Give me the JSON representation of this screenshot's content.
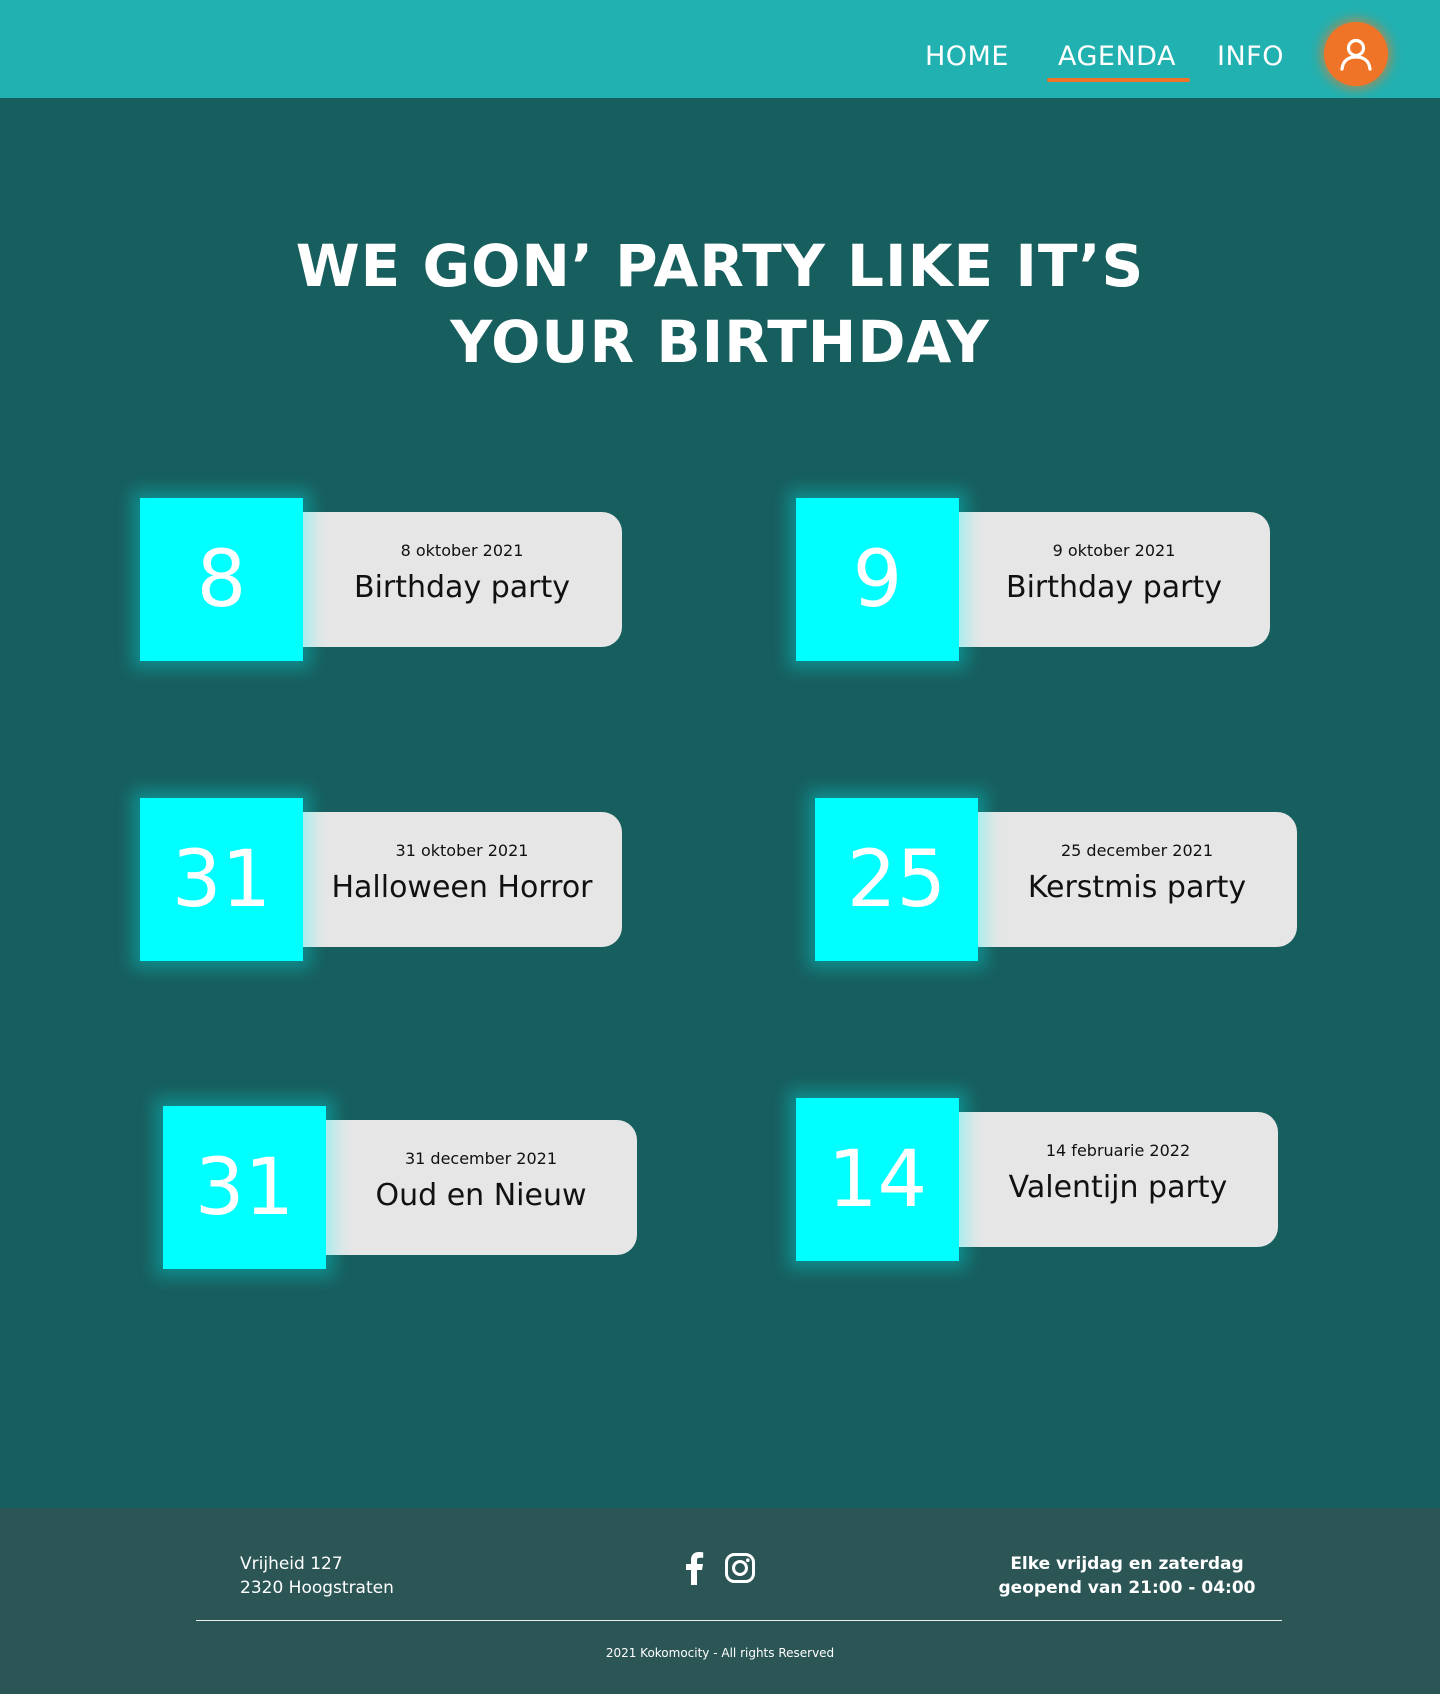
{
  "header": {
    "nav": [
      {
        "label": "HOME",
        "active": false
      },
      {
        "label": "AGENDA",
        "active": true
      },
      {
        "label": "INFO",
        "active": false
      }
    ],
    "avatar_icon": "user-icon",
    "accent_color": "#f07427",
    "bar_color": "#22b1b1"
  },
  "hero": {
    "title_line1": "WE GON’ PARTY LIKE IT’S",
    "title_line2": "YOUR BIRTHDAY"
  },
  "events": [
    {
      "day": "8",
      "date": "8 oktober 2021",
      "name": "Birthday party"
    },
    {
      "day": "9",
      "date": "9 oktober 2021",
      "name": "Birthday party"
    },
    {
      "day": "31",
      "date": "31 oktober 2021",
      "name": "Halloween Horror"
    },
    {
      "day": "25",
      "date": "25 december 2021",
      "name": "Kerstmis party"
    },
    {
      "day": "31",
      "date": "31 december 2021",
      "name": "Oud en Nieuw"
    },
    {
      "day": "14",
      "date": "14 februarie 2022",
      "name": "Valentijn party"
    }
  ],
  "event_box_color": "#00ffff",
  "footer": {
    "address_line1": "Vrijheid 127",
    "address_line2": "2320 Hoogstraten",
    "social_icons": [
      "facebook-icon",
      "instagram-icon"
    ],
    "hours_line1": "Elke vrijdag en zaterdag",
    "hours_line2": "geopend van 21:00 - 04:00",
    "copyright": "2021 Kokomocity - All rights Reserved"
  }
}
